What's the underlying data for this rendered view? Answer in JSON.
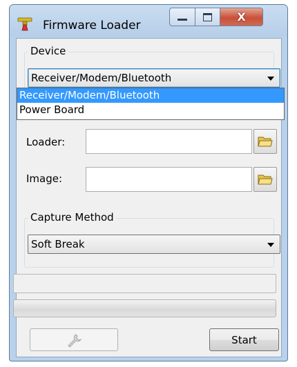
{
  "window": {
    "title": "Firmware Loader"
  },
  "title_controls": {
    "minimize_icon": "minimize-icon",
    "maximize_icon": "maximize-icon",
    "close_icon": "close-icon",
    "close_glyph": "X"
  },
  "device": {
    "group_label": "Device",
    "selected": "Receiver/Modem/Bluetooth",
    "options": [
      "Receiver/Modem/Bluetooth",
      "Power Board"
    ],
    "dropdown_open": true
  },
  "files": {
    "loader_label": "Loader:",
    "loader_value": "",
    "image_label": "Image:",
    "image_value": "",
    "browse_icon": "folder-icon"
  },
  "capture": {
    "group_label": "Capture Method",
    "selected": "Soft Break"
  },
  "status": {
    "text": ""
  },
  "progress": {
    "value": 0
  },
  "buttons": {
    "tools_icon": "wrench-icon",
    "tools_enabled": false,
    "start_label": "Start"
  },
  "colors": {
    "selection": "#3399ff",
    "window_frame": "#b9d1ea",
    "close_button": "#c9503a"
  }
}
